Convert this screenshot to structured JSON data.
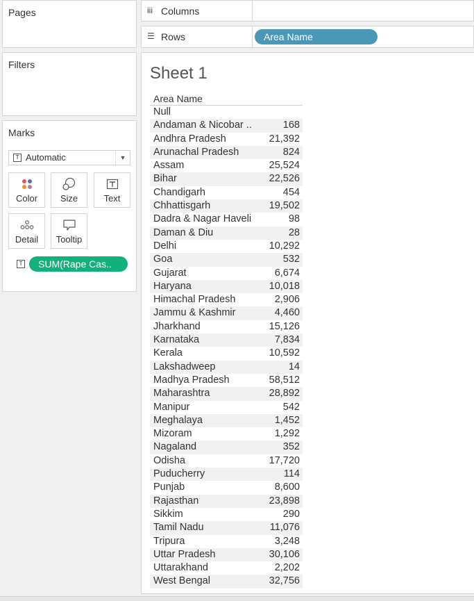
{
  "pages": {
    "title": "Pages"
  },
  "filters": {
    "title": "Filters"
  },
  "marks": {
    "title": "Marks",
    "mark_type": "Automatic",
    "buttons": {
      "color": "Color",
      "size": "Size",
      "text": "Text",
      "detail": "Detail",
      "tooltip": "Tooltip"
    },
    "text_field": "SUM(Rape Cas..",
    "field_icon": "T"
  },
  "shelves": {
    "columns_label": "Columns",
    "rows_label": "Rows",
    "rows_pill": "Area Name"
  },
  "sheet": {
    "title": "Sheet 1",
    "column_header": "Area Name",
    "rows": [
      {
        "name": "Null",
        "value": ""
      },
      {
        "name": "Andaman & Nicobar ..",
        "value": "168"
      },
      {
        "name": "Andhra Pradesh",
        "value": "21,392"
      },
      {
        "name": "Arunachal Pradesh",
        "value": "824"
      },
      {
        "name": "Assam",
        "value": "25,524"
      },
      {
        "name": "Bihar",
        "value": "22,526"
      },
      {
        "name": "Chandigarh",
        "value": "454"
      },
      {
        "name": "Chhattisgarh",
        "value": "19,502"
      },
      {
        "name": "Dadra & Nagar Haveli",
        "value": "98"
      },
      {
        "name": "Daman & Diu",
        "value": "28"
      },
      {
        "name": "Delhi",
        "value": "10,292"
      },
      {
        "name": "Goa",
        "value": "532"
      },
      {
        "name": "Gujarat",
        "value": "6,674"
      },
      {
        "name": "Haryana",
        "value": "10,018"
      },
      {
        "name": "Himachal Pradesh",
        "value": "2,906"
      },
      {
        "name": "Jammu & Kashmir",
        "value": "4,460"
      },
      {
        "name": "Jharkhand",
        "value": "15,126"
      },
      {
        "name": "Karnataka",
        "value": "7,834"
      },
      {
        "name": "Kerala",
        "value": "10,592"
      },
      {
        "name": "Lakshadweep",
        "value": "14"
      },
      {
        "name": "Madhya Pradesh",
        "value": "58,512"
      },
      {
        "name": "Maharashtra",
        "value": "28,892"
      },
      {
        "name": "Manipur",
        "value": "542"
      },
      {
        "name": "Meghalaya",
        "value": "1,452"
      },
      {
        "name": "Mizoram",
        "value": "1,292"
      },
      {
        "name": "Nagaland",
        "value": "352"
      },
      {
        "name": "Odisha",
        "value": "17,720"
      },
      {
        "name": "Puducherry",
        "value": "114"
      },
      {
        "name": "Punjab",
        "value": "8,600"
      },
      {
        "name": "Rajasthan",
        "value": "23,898"
      },
      {
        "name": "Sikkim",
        "value": "290"
      },
      {
        "name": "Tamil Nadu",
        "value": "11,076"
      },
      {
        "name": "Tripura",
        "value": "3,248"
      },
      {
        "name": "Uttar Pradesh",
        "value": "30,106"
      },
      {
        "name": "Uttarakhand",
        "value": "2,202"
      },
      {
        "name": "West Bengal",
        "value": "32,756"
      }
    ]
  },
  "colors": {
    "rows_pill": "#4b97b6",
    "measure_pill": "#13b17a"
  }
}
